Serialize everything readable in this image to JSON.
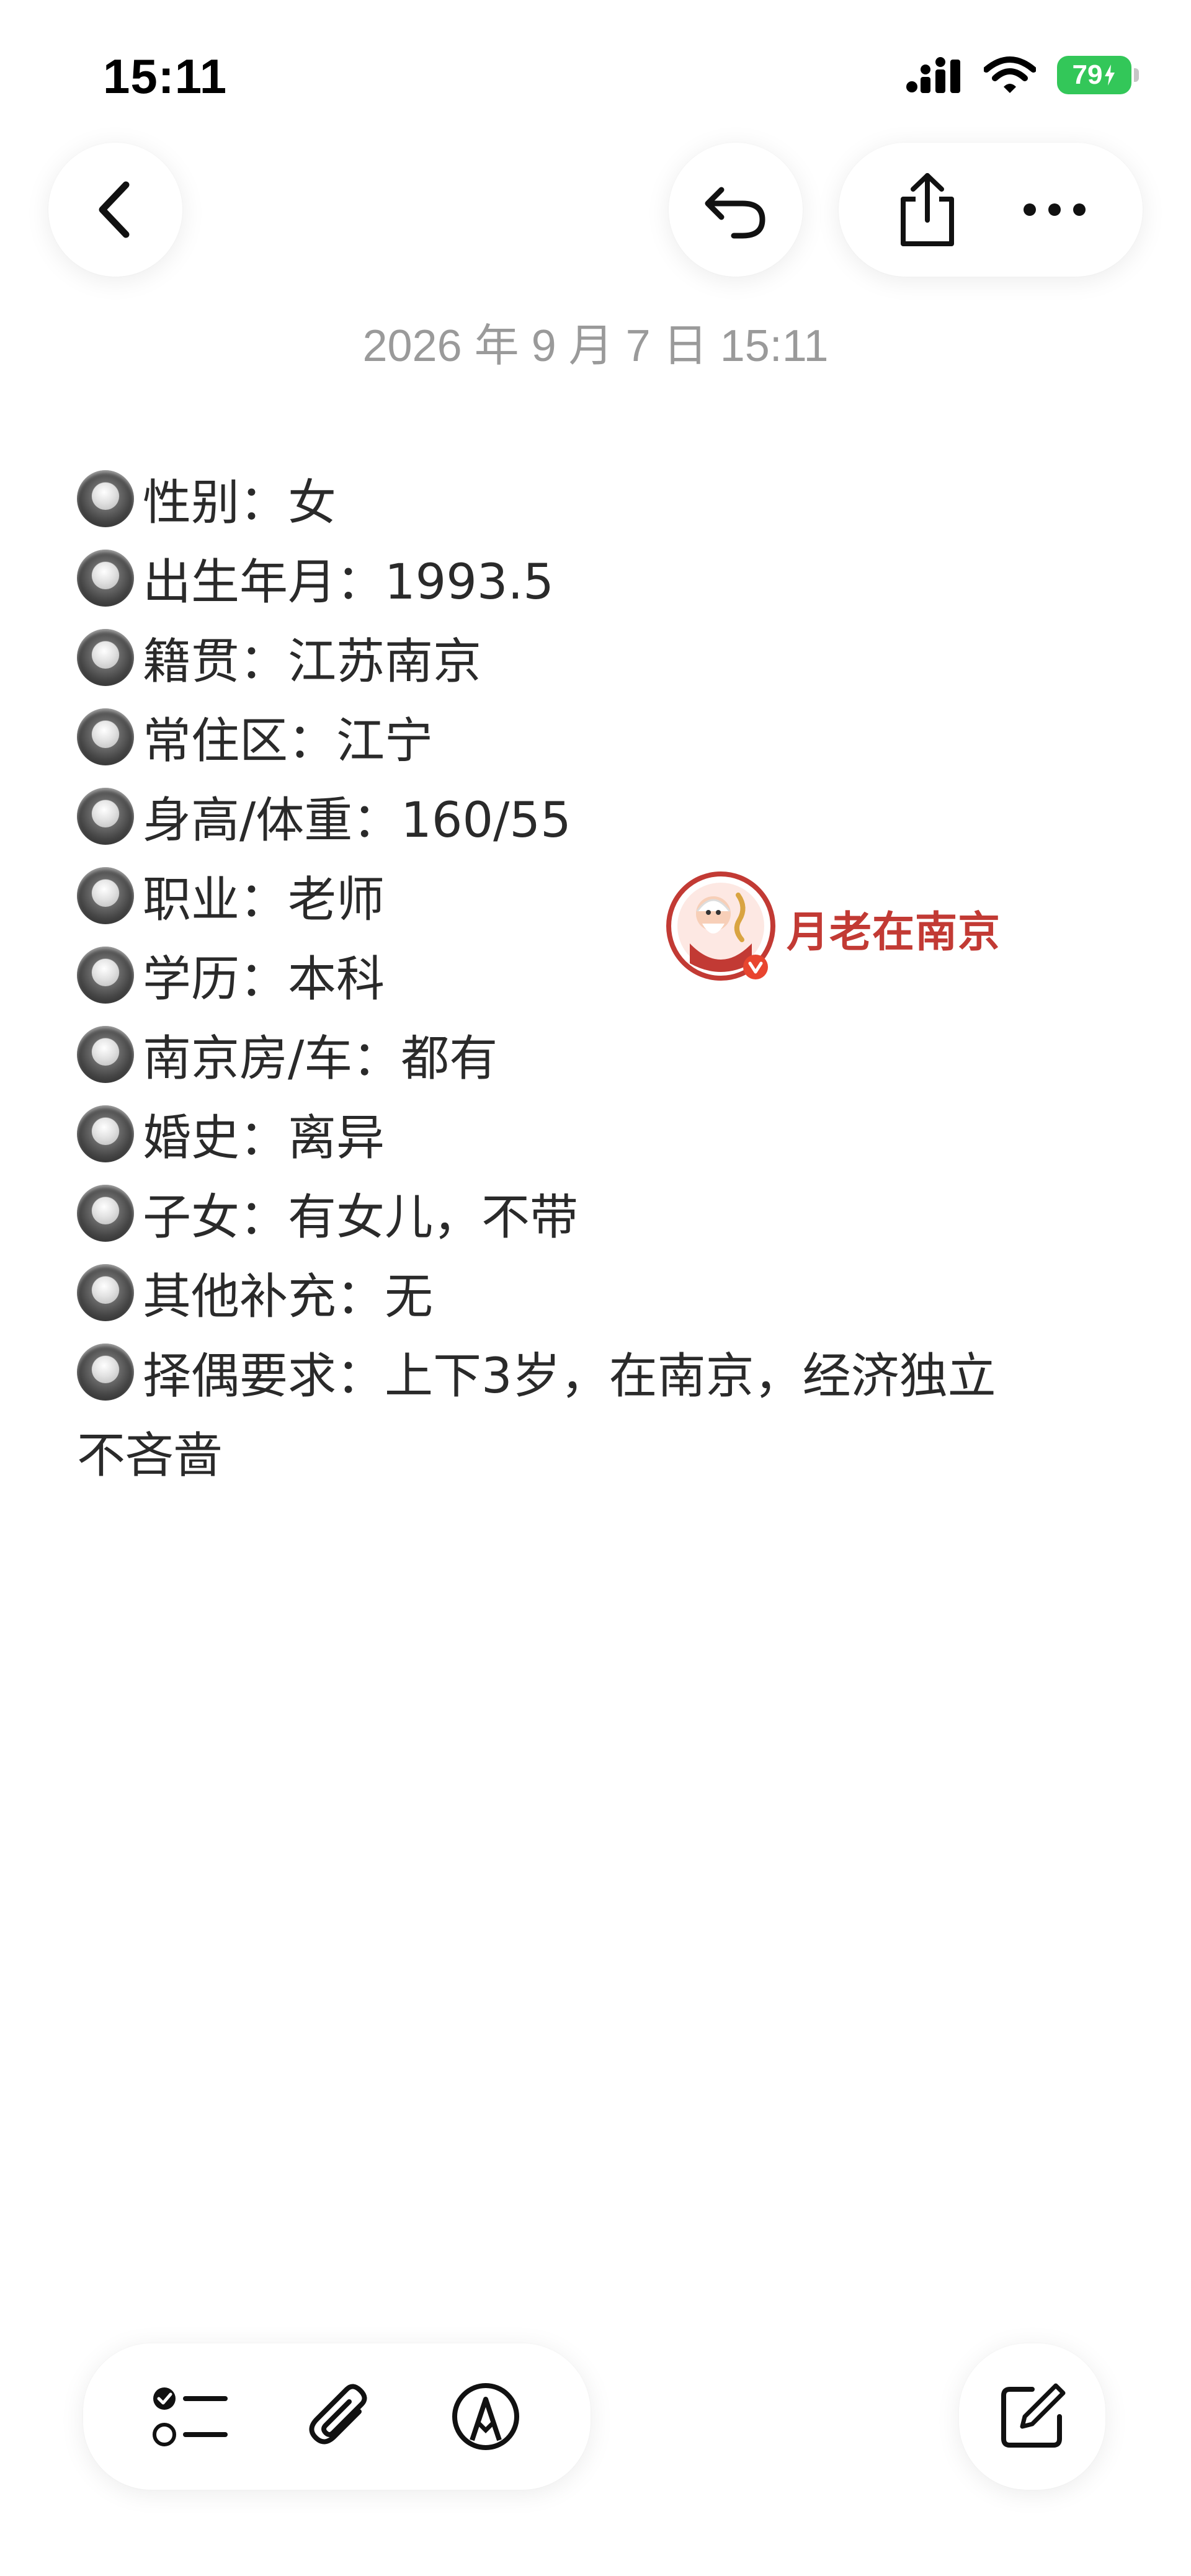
{
  "status_bar": {
    "time": "15:11",
    "battery_level": "79",
    "icons": [
      "cellular-signal-icon",
      "wifi-icon",
      "battery-charging-icon"
    ],
    "battery_color": "#33c759"
  },
  "toolbar_top": {
    "icons": [
      "chevron-left-icon",
      "undo-icon",
      "share-icon",
      "more-icon"
    ]
  },
  "note": {
    "date": "2026 年 9 月 7 日 15:11",
    "lines": [
      "性别：女",
      "出生年月：1993.5",
      "籍贯：江苏南京",
      "常住区：江宁",
      "身高/体重：160/55",
      "职业：老师",
      "学历：本科",
      "南京房/车：都有",
      "婚史：离异",
      "子女：有女儿，不带",
      "其他补充：无",
      "择偶要求：上下3岁，在南京，经济独立",
      "不吝啬"
    ]
  },
  "watermark": {
    "text": "月老在南京",
    "color": "#c23a34"
  },
  "toolbar_bottom": {
    "icons": [
      "checklist-icon",
      "paperclip-icon",
      "markup-pen-icon",
      "compose-icon"
    ]
  }
}
